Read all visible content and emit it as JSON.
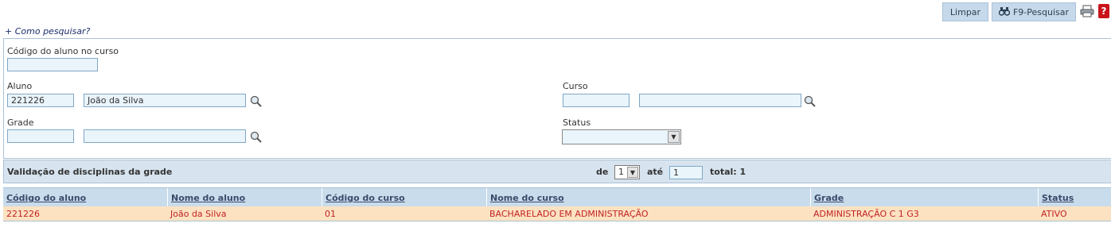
{
  "toolbar": {
    "limpar_label": "Limpar",
    "pesquisar_label": "F9-Pesquisar",
    "help_label": "?"
  },
  "como_pesquisar": "+ Como pesquisar?",
  "form": {
    "codigo_aluno_label": "Código do aluno no curso",
    "codigo_aluno_value": "",
    "aluno_label": "Aluno",
    "aluno_codigo": "221226",
    "aluno_nome": "João da Silva",
    "curso_label": "Curso",
    "curso_codigo": "",
    "curso_nome": "",
    "grade_label": "Grade",
    "grade_codigo": "",
    "grade_nome": "",
    "status_label": "Status",
    "status_value": ""
  },
  "section": {
    "title": "Validação de disciplinas da grade",
    "de_label": "de",
    "page_value": "1",
    "ate_label": "até",
    "ate_value": "1",
    "total_label": "total: 1"
  },
  "table": {
    "columns": [
      "Código do aluno",
      "Nome do aluno",
      "Código do curso",
      "Nome do curso",
      "Grade",
      "Status"
    ],
    "rows": [
      [
        "221226",
        "João da Silva",
        "01",
        "BACHARELADO EM ADMINISTRAÇÃO",
        "ADMINISTRAÇÃO C 1 G3",
        "ATIVO"
      ]
    ]
  },
  "colors": {
    "header_bg": "#c9dcec",
    "row_highlight": "#fde2c2",
    "row_text": "#c02323",
    "input_bg": "#eaf4fb"
  }
}
